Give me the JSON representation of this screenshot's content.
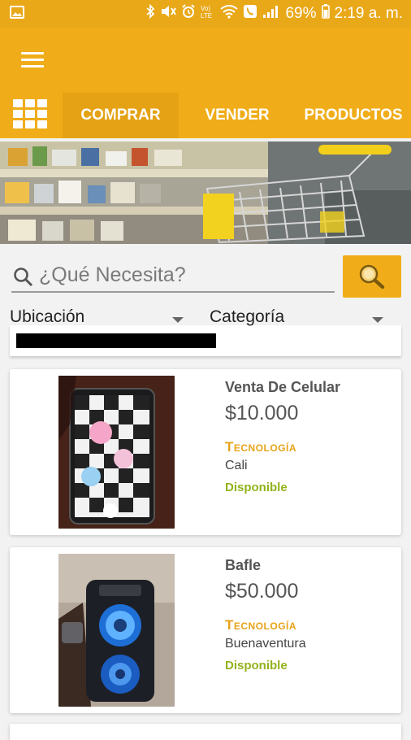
{
  "status_bar": {
    "battery": "69%",
    "time": "2:19 a. m.",
    "left_icon": "image-notification-icon",
    "right_icons": [
      "bluetooth-icon",
      "mute-icon",
      "alarm-icon",
      "volte-icon",
      "wifi-icon",
      "call-icon",
      "signal-icon",
      "battery-icon"
    ]
  },
  "colors": {
    "primary": "#f0ad19",
    "accent": "#e8a31a",
    "available": "#93b21c"
  },
  "tabs": [
    {
      "label": "COMPRAR",
      "active": true
    },
    {
      "label": "VENDER",
      "active": false
    },
    {
      "label": "PRODUCTOS",
      "active": false
    }
  ],
  "search": {
    "placeholder": "¿Qué Necesita?"
  },
  "filters": {
    "location_label": "Ubicación",
    "category_label": "Categoría"
  },
  "products": [
    {
      "title": "Venta De Celular",
      "price": "$10.000",
      "category": "Tecnología",
      "city": "Cali",
      "status": "Disponible"
    },
    {
      "title": "Bafle",
      "price": "$50.000",
      "category": "Tecnología",
      "city": "Buenaventura",
      "status": "Disponible"
    }
  ]
}
